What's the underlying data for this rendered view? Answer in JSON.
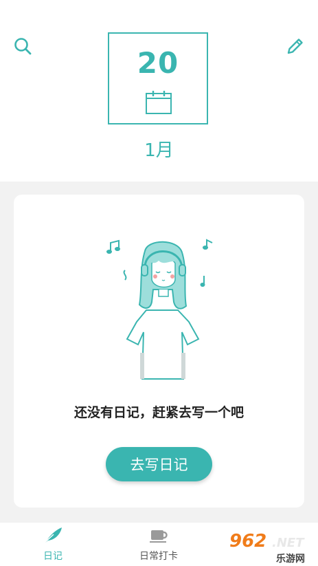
{
  "header": {
    "date_day": "20",
    "month": "1月",
    "search_icon": "search-icon",
    "edit_icon": "pencil-icon",
    "calendar_icon": "calendar-icon"
  },
  "empty_state": {
    "message": "还没有日记，赶紧去写一个吧",
    "button_label": "去写日记",
    "illustration": "girl-with-headphones-illustration"
  },
  "tabbar": {
    "tabs": [
      {
        "label": "日记",
        "icon": "feather-icon",
        "active": true
      },
      {
        "label": "日常打卡",
        "icon": "coffee-cup-icon",
        "active": false
      }
    ]
  },
  "watermark": {
    "logo": "962",
    "net": ".NET",
    "sub": "乐游网"
  },
  "colors": {
    "accent": "#3ab5b0",
    "background": "#f2f2f2",
    "card": "#ffffff"
  }
}
